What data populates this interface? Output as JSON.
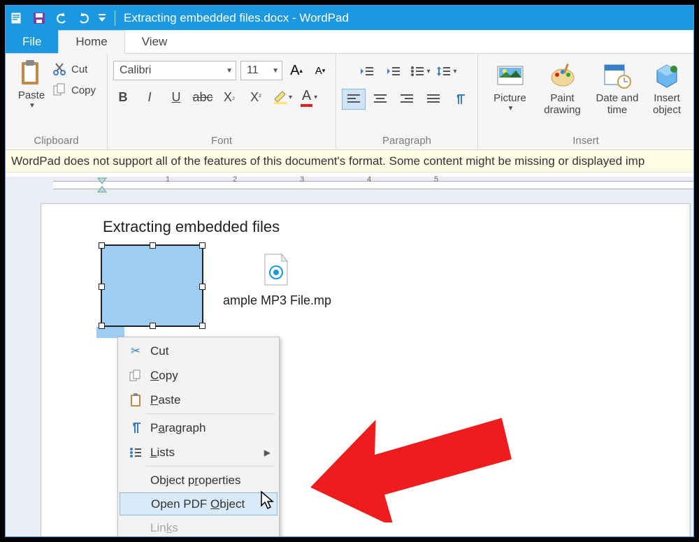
{
  "titlebar": {
    "title": "Extracting embedded files.docx - WordPad"
  },
  "tabs": {
    "file": "File",
    "home": "Home",
    "view": "View"
  },
  "clipboard": {
    "group": "Clipboard",
    "paste": "Paste",
    "cut": "Cut",
    "copy": "Copy"
  },
  "font": {
    "group": "Font",
    "name": "Calibri",
    "size": "11"
  },
  "paragraph": {
    "group": "Paragraph"
  },
  "insert": {
    "group": "Insert",
    "picture": "Picture",
    "paint": "Paint drawing",
    "datetime": "Date and time",
    "object": "Insert object"
  },
  "warning": "WordPad does not support all of the features of this document's format. Some content might be missing or displayed imp",
  "document": {
    "heading": "Extracting embedded files",
    "mp3_label": "ample MP3 File.mp"
  },
  "ruler_numbers": [
    "1",
    "2",
    "3",
    "4",
    "5"
  ],
  "context_menu": {
    "cut": "Cut",
    "copy": "Copy",
    "paste": "Paste",
    "paragraph": "Paragraph",
    "lists": "Lists",
    "props": "Object properties",
    "open": "Open PDF Object",
    "links": "Links"
  }
}
